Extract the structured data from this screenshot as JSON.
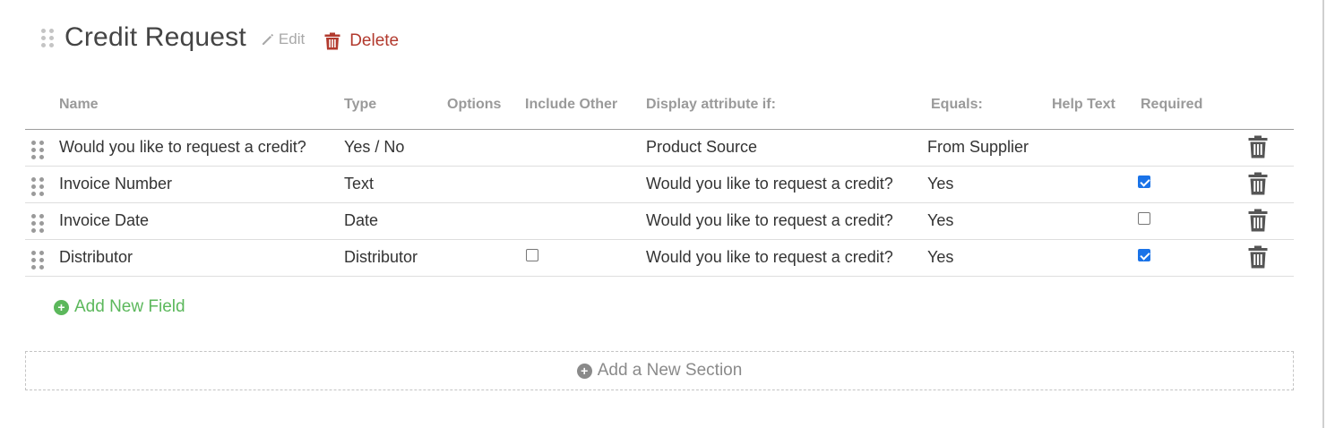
{
  "section": {
    "title": "Credit Request",
    "edit_label": "Edit",
    "delete_label": "Delete"
  },
  "table": {
    "columns": [
      {
        "key": "name",
        "label": "Name"
      },
      {
        "key": "type",
        "label": "Type"
      },
      {
        "key": "options",
        "label": "Options"
      },
      {
        "key": "include_other",
        "label": "Include Other"
      },
      {
        "key": "display_if",
        "label": "Display attribute if:"
      },
      {
        "key": "equals",
        "label": "Equals:"
      },
      {
        "key": "help_text",
        "label": "Help Text"
      },
      {
        "key": "required",
        "label": "Required"
      }
    ],
    "rows": [
      {
        "name": "Would you like to request a credit?",
        "type": "Yes / No",
        "options": "",
        "include_other": null,
        "display_if": "Product Source",
        "equals": "From Supplier",
        "help_text": "",
        "required": null
      },
      {
        "name": "Invoice Number",
        "type": "Text",
        "options": "",
        "include_other": null,
        "display_if": "Would you like to request a credit?",
        "equals": "Yes",
        "help_text": "",
        "required": true
      },
      {
        "name": "Invoice Date",
        "type": "Date",
        "options": "",
        "include_other": null,
        "display_if": "Would you like to request a credit?",
        "equals": "Yes",
        "help_text": "",
        "required": false
      },
      {
        "name": "Distributor",
        "type": "Distributor",
        "options": "",
        "include_other": false,
        "display_if": "Would you like to request a credit?",
        "equals": "Yes",
        "help_text": "",
        "required": true
      }
    ]
  },
  "actions": {
    "add_field_label": "Add New Field",
    "add_section_label": "Add a New Section"
  },
  "icons": {
    "drag": "drag-handle-icon",
    "edit": "pencil-icon",
    "delete": "trash-icon",
    "add": "plus-circle-icon"
  },
  "colors": {
    "delete": "#b23a2e",
    "add_field": "#5cb85c",
    "checkbox_checked": "#1a73e8",
    "muted": "#9a9a9a"
  }
}
